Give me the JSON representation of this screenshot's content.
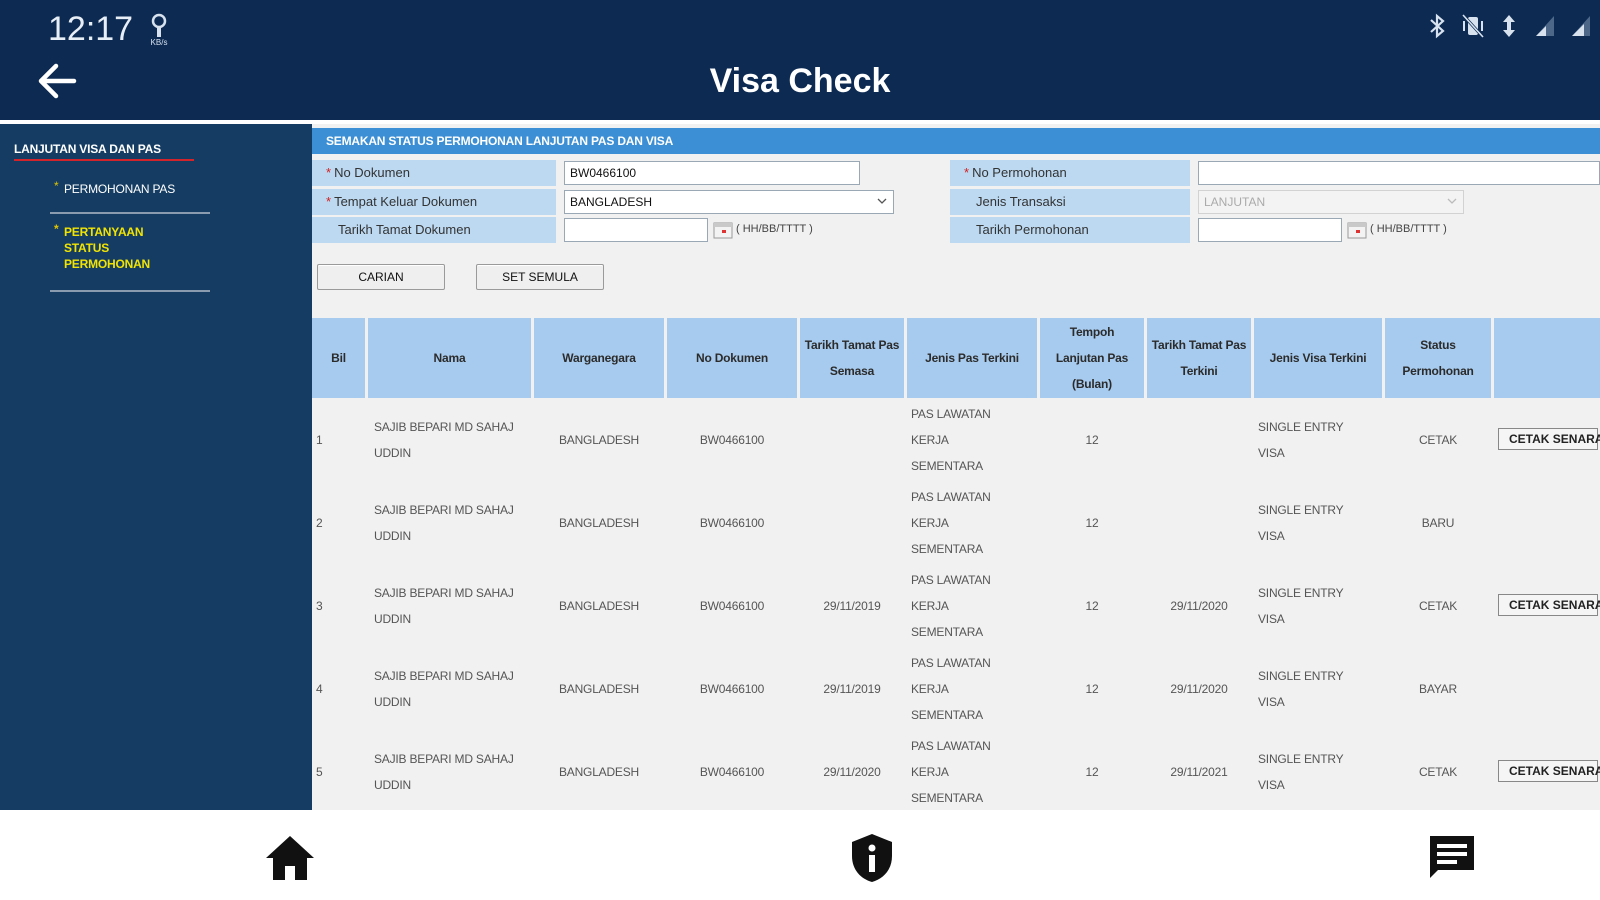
{
  "status_bar": {
    "time": "12:17",
    "icons": [
      "bluetooth-icon",
      "vibrate-icon",
      "data-icon",
      "signal-icon",
      "signal-icon"
    ]
  },
  "appbar": {
    "title": "Visa Check",
    "back_icon": "arrow-left-icon"
  },
  "sidebar": {
    "heading": "LANJUTAN VISA DAN PAS",
    "items": [
      {
        "label": "PERMOHONAN PAS",
        "active": false
      },
      {
        "label": "PERTANYAAN STATUS PERMOHONAN",
        "active": true
      }
    ]
  },
  "form": {
    "header": "SEMAKAN STATUS PERMOHONAN LANJUTAN PAS DAN VISA",
    "fields": {
      "no_dokumen": {
        "label": "No Dokumen",
        "value": "BW0466100",
        "required": true
      },
      "tempat_keluar": {
        "label": "Tempat Keluar Dokumen",
        "value": "BANGLADESH",
        "required": true
      },
      "tarikh_tamat": {
        "label": "Tarikh Tamat Dokumen",
        "value": "",
        "hint": "( HH/BB/TTTT )"
      },
      "no_permohonan": {
        "label": "No Permohonan",
        "value": "",
        "required": true
      },
      "jenis_transaksi": {
        "label": "Jenis Transaksi",
        "value": "LANJUTAN"
      },
      "tarikh_permohonan": {
        "label": "Tarikh Permohonan",
        "value": "",
        "hint": "( HH/BB/TTTT )"
      }
    },
    "buttons": {
      "search": "CARIAN",
      "reset": "SET SEMULA"
    }
  },
  "table": {
    "headers": [
      "Bil",
      "Nama",
      "Warganegara",
      "No Dokumen",
      "Tarikh Tamat Pas Semasa",
      "Jenis Pas Terkini",
      "Tempoh Lanjutan Pas (Bulan)",
      "Tarikh Tamat Pas Terkini",
      "Jenis Visa Terkini",
      "Status Permohonan",
      ""
    ],
    "rows": [
      {
        "bil": "1",
        "nama": "SAJIB BEPARI MD SAHAJ UDDIN",
        "warganegara": "BANGLADESH",
        "no_dokumen": "BW0466100",
        "tarikh_semasa": "",
        "jenis_pas": "PAS LAWATAN KERJA SEMENTARA",
        "tempoh": "12",
        "tarikh_terkini": "",
        "jenis_visa": "SINGLE ENTRY VISA",
        "status": "CETAK",
        "action": "CETAK SENARAI"
      },
      {
        "bil": "2",
        "nama": "SAJIB BEPARI MD SAHAJ UDDIN",
        "warganegara": "BANGLADESH",
        "no_dokumen": "BW0466100",
        "tarikh_semasa": "",
        "jenis_pas": "PAS LAWATAN KERJA SEMENTARA",
        "tempoh": "12",
        "tarikh_terkini": "",
        "jenis_visa": "SINGLE ENTRY VISA",
        "status": "BARU",
        "action": ""
      },
      {
        "bil": "3",
        "nama": "SAJIB BEPARI MD SAHAJ UDDIN",
        "warganegara": "BANGLADESH",
        "no_dokumen": "BW0466100",
        "tarikh_semasa": "29/11/2019",
        "jenis_pas": "PAS LAWATAN KERJA SEMENTARA",
        "tempoh": "12",
        "tarikh_terkini": "29/11/2020",
        "jenis_visa": "SINGLE ENTRY VISA",
        "status": "CETAK",
        "action": "CETAK SENARAI"
      },
      {
        "bil": "4",
        "nama": "SAJIB BEPARI MD SAHAJ UDDIN",
        "warganegara": "BANGLADESH",
        "no_dokumen": "BW0466100",
        "tarikh_semasa": "29/11/2019",
        "jenis_pas": "PAS LAWATAN KERJA SEMENTARA",
        "tempoh": "12",
        "tarikh_terkini": "29/11/2020",
        "jenis_visa": "SINGLE ENTRY VISA",
        "status": "BAYAR",
        "action": ""
      },
      {
        "bil": "5",
        "nama": "SAJIB BEPARI MD SAHAJ UDDIN",
        "warganegara": "BANGLADESH",
        "no_dokumen": "BW0466100",
        "tarikh_semasa": "29/11/2020",
        "jenis_pas": "PAS LAWATAN KERJA SEMENTARA",
        "tempoh": "12",
        "tarikh_terkini": "29/11/2021",
        "jenis_visa": "SINGLE ENTRY VISA",
        "status": "CETAK",
        "action": "CETAK SENARAI"
      }
    ]
  },
  "bottom_nav": {
    "items": [
      "home-icon",
      "info-shield-icon",
      "message-icon"
    ]
  },
  "colors": {
    "appbar": "#0c2a52",
    "sidebar": "#153d63",
    "header_blue": "#3c8fd4",
    "label_blue": "#bcd9f1",
    "table_header": "#a7cbee",
    "active_yellow": "#f2e400"
  }
}
